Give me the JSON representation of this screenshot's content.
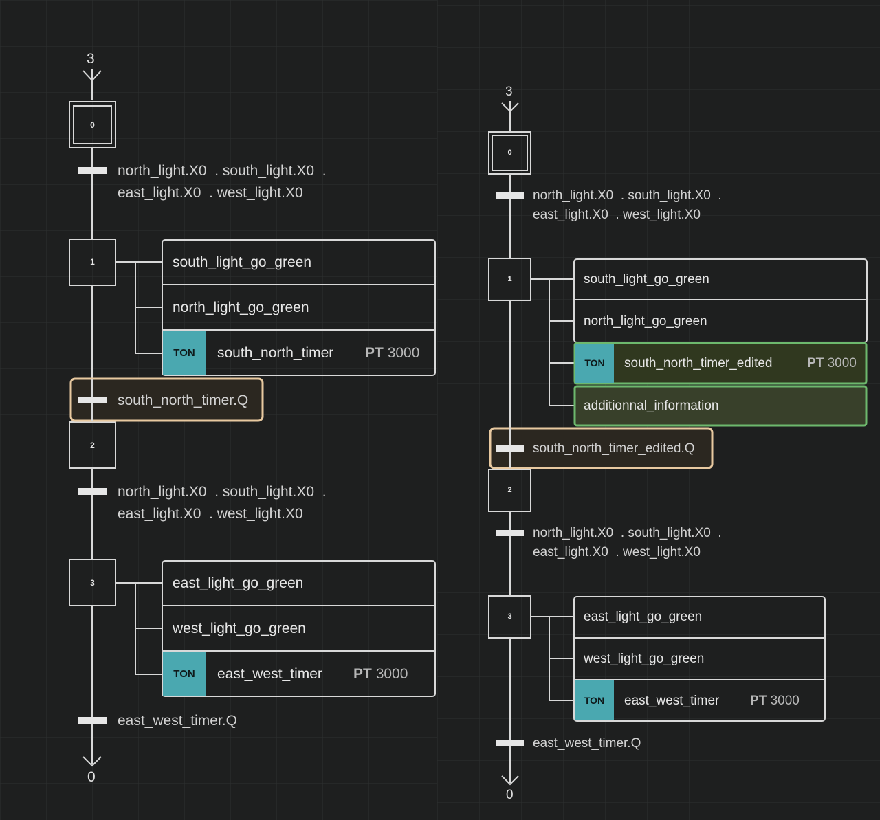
{
  "colors": {
    "background": "#1e1f1f",
    "grid": "#2e3030",
    "line": "#d8d8d8",
    "ton": "#4aa8b0",
    "highlight_orange": "#e8c9a0",
    "highlight_green": "#6db86d",
    "green_fill": "#38402a"
  },
  "left": {
    "initial_top": "3",
    "step0": "0",
    "step1": "1",
    "step2": "2",
    "step3": "3",
    "t1": {
      "line1a": "north_light.X0",
      "line1b": ". south_light.X0",
      "line1c": ".",
      "line2a": "east_light.X0",
      "line2b": ". west_light.X0"
    },
    "step1_actions": {
      "a1": "south_light_go_green",
      "a2": "north_light_go_green",
      "ton": "TON",
      "timer": "south_north_timer",
      "pt": "PT",
      "ptv": "3000"
    },
    "t2": "south_north_timer.Q",
    "t3": {
      "line1a": "north_light.X0",
      "line1b": ". south_light.X0",
      "line1c": ".",
      "line2a": "east_light.X0",
      "line2b": ". west_light.X0"
    },
    "step3_actions": {
      "a1": "east_light_go_green",
      "a2": "west_light_go_green",
      "ton": "TON",
      "timer": "east_west_timer",
      "pt": "PT",
      "ptv": "3000"
    },
    "t4": "east_west_timer.Q",
    "final_bottom": "0"
  },
  "right": {
    "initial_top": "3",
    "step0": "0",
    "step1": "1",
    "step2": "2",
    "step3": "3",
    "t1": {
      "line1a": "north_light.X0",
      "line1b": ". south_light.X0",
      "line1c": ".",
      "line2a": "east_light.X0",
      "line2b": ". west_light.X0"
    },
    "step1_actions": {
      "a1": "south_light_go_green",
      "a2": "north_light_go_green",
      "ton": "TON",
      "timer": "south_north_timer_edited",
      "pt": "PT",
      "ptv": "3000",
      "a4": "additionnal_information"
    },
    "t2": "south_north_timer_edited.Q",
    "t3": {
      "line1a": "north_light.X0",
      "line1b": ". south_light.X0",
      "line1c": ".",
      "line2a": "east_light.X0",
      "line2b": ". west_light.X0"
    },
    "step3_actions": {
      "a1": "east_light_go_green",
      "a2": "west_light_go_green",
      "ton": "TON",
      "timer": "east_west_timer",
      "pt": "PT",
      "ptv": "3000"
    },
    "t4": "east_west_timer.Q",
    "final_bottom": "0"
  }
}
